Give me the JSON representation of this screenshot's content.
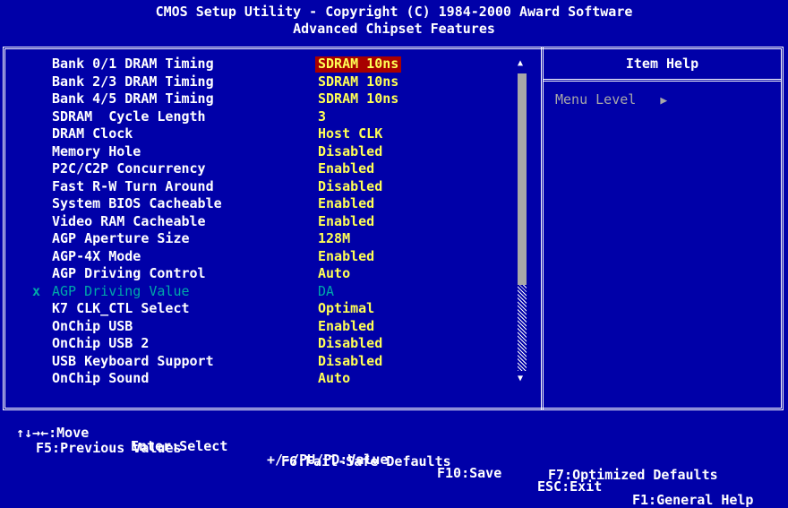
{
  "header": {
    "title": "CMOS Setup Utility - Copyright (C) 1984-2000 Award Software",
    "subtitle": "Advanced Chipset Features"
  },
  "help_panel": {
    "title": "Item Help",
    "menu_level_label": "Menu Level",
    "menu_level_arrow": "▶"
  },
  "settings": [
    {
      "label": "Bank 0/1 DRAM Timing",
      "value": "SDRAM 10ns",
      "selected": true
    },
    {
      "label": "Bank 2/3 DRAM Timing",
      "value": "SDRAM 10ns"
    },
    {
      "label": "Bank 4/5 DRAM Timing",
      "value": "SDRAM 10ns"
    },
    {
      "label": "SDRAM  Cycle Length",
      "value": "3"
    },
    {
      "label": "DRAM Clock",
      "value": "Host CLK"
    },
    {
      "label": "Memory Hole",
      "value": "Disabled"
    },
    {
      "label": "P2C/C2P Concurrency",
      "value": "Enabled"
    },
    {
      "label": "Fast R-W Turn Around",
      "value": "Disabled"
    },
    {
      "label": "System BIOS Cacheable",
      "value": "Enabled"
    },
    {
      "label": "Video RAM Cacheable",
      "value": "Enabled"
    },
    {
      "label": "AGP Aperture Size",
      "value": "128M"
    },
    {
      "label": "AGP-4X Mode",
      "value": "Enabled"
    },
    {
      "label": "AGP Driving Control",
      "value": "Auto"
    },
    {
      "label": "AGP Driving Value",
      "value": "DA",
      "disabled": true,
      "mark": "x"
    },
    {
      "label": "K7 CLK_CTL Select",
      "value": "Optimal"
    },
    {
      "label": "OnChip USB",
      "value": "Enabled"
    },
    {
      "label": "OnChip USB 2",
      "value": "Disabled"
    },
    {
      "label": "USB Keyboard Support",
      "value": "Disabled"
    },
    {
      "label": "OnChip Sound",
      "value": "Auto"
    }
  ],
  "scrollbar": {
    "up_arrow": "▲",
    "down_arrow": "▼"
  },
  "footer": {
    "row1": {
      "move": "↑↓→←:Move",
      "enter": "Enter:Select",
      "value": "+/-/PU/PD:Value",
      "save": "F10:Save",
      "exit": "ESC:Exit",
      "help": "F1:General Help"
    },
    "row2": {
      "previous": "F5:Previous Values",
      "failsafe": "F6:Fail-Safe Defaults",
      "optimized": "F7:Optimized Defaults"
    }
  },
  "colors": {
    "background": "#0000a8",
    "value_text": "#ffff54",
    "selected_bg": "#a80000",
    "disabled_text": "#00a8a8"
  }
}
